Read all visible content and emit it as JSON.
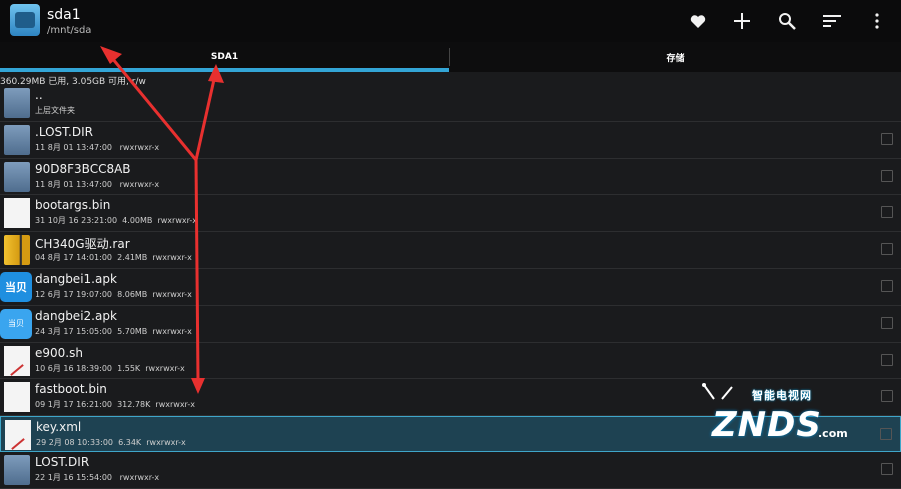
{
  "actionbar": {
    "title": "sda1",
    "subtitle": "/mnt/sda",
    "actions": [
      "heart-icon",
      "add-icon",
      "search-icon",
      "sort-icon",
      "overflow-menu-icon"
    ]
  },
  "tabs": [
    {
      "label": "SDA1",
      "active": true
    },
    {
      "label": "存储",
      "active": false
    }
  ],
  "storage_info": "360.29MB 已用, 3.05GB 可用, r/w",
  "files": [
    {
      "name": "..",
      "meta": "上层文件夹",
      "icon": "folder-icon"
    },
    {
      "name": ".LOST.DIR",
      "meta": "11 8月 01 13:47:00   rwxrwxr-x",
      "icon": "folder-icon"
    },
    {
      "name": "90D8F3BCC8AB",
      "meta": "11 8月 01 13:47:00   rwxrwxr-x",
      "icon": "folder-icon"
    },
    {
      "name": "bootargs.bin",
      "meta": "31 10月 16 23:21:00  4.00MB  rwxrwxr-x",
      "icon": "document-icon"
    },
    {
      "name": "CH340G驱动.rar",
      "meta": "04 8月 17 14:01:00  2.41MB  rwxrwxr-x",
      "icon": "archive-icon"
    },
    {
      "name": "dangbei1.apk",
      "meta": "12 6月 17 19:07:00  8.06MB  rwxrwxr-x",
      "icon": "apk-icon",
      "icon_text": "当贝"
    },
    {
      "name": "dangbei2.apk",
      "meta": "24 3月 17 15:05:00  5.70MB  rwxrwxr-x",
      "icon": "apk-icon",
      "icon_text": "当贝"
    },
    {
      "name": "e900.sh",
      "meta": "10 6月 16 18:39:00  1.55K  rwxrwxr-x",
      "icon": "script-icon"
    },
    {
      "name": "fastboot.bin",
      "meta": "09 1月 17 16:21:00  312.78K  rwxrwxr-x",
      "icon": "document-icon"
    },
    {
      "name": "key.xml",
      "meta": "29 2月 08 10:33:00  6.34K  rwxrwxr-x",
      "icon": "script-icon",
      "selected": true
    },
    {
      "name": "LOST.DIR",
      "meta": "22 1月 16 15:54:00   rwxrwxr-x",
      "icon": "folder-icon"
    }
  ],
  "watermark": {
    "cn": "智能电视网",
    "en": "ZNDS",
    "suffix": ".com"
  },
  "colors": {
    "accent": "#33a5d6",
    "arrow": "#e8302f",
    "selected_row": "#1e4252"
  }
}
